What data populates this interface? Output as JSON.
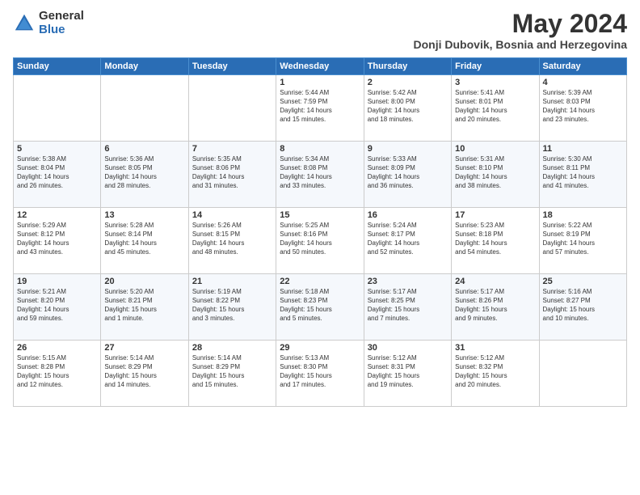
{
  "logo": {
    "general": "General",
    "blue": "Blue"
  },
  "title": "May 2024",
  "location": "Donji Dubovik, Bosnia and Herzegovina",
  "days_of_week": [
    "Sunday",
    "Monday",
    "Tuesday",
    "Wednesday",
    "Thursday",
    "Friday",
    "Saturday"
  ],
  "weeks": [
    [
      {
        "day": "",
        "info": ""
      },
      {
        "day": "",
        "info": ""
      },
      {
        "day": "",
        "info": ""
      },
      {
        "day": "1",
        "info": "Sunrise: 5:44 AM\nSunset: 7:59 PM\nDaylight: 14 hours\nand 15 minutes."
      },
      {
        "day": "2",
        "info": "Sunrise: 5:42 AM\nSunset: 8:00 PM\nDaylight: 14 hours\nand 18 minutes."
      },
      {
        "day": "3",
        "info": "Sunrise: 5:41 AM\nSunset: 8:01 PM\nDaylight: 14 hours\nand 20 minutes."
      },
      {
        "day": "4",
        "info": "Sunrise: 5:39 AM\nSunset: 8:03 PM\nDaylight: 14 hours\nand 23 minutes."
      }
    ],
    [
      {
        "day": "5",
        "info": "Sunrise: 5:38 AM\nSunset: 8:04 PM\nDaylight: 14 hours\nand 26 minutes."
      },
      {
        "day": "6",
        "info": "Sunrise: 5:36 AM\nSunset: 8:05 PM\nDaylight: 14 hours\nand 28 minutes."
      },
      {
        "day": "7",
        "info": "Sunrise: 5:35 AM\nSunset: 8:06 PM\nDaylight: 14 hours\nand 31 minutes."
      },
      {
        "day": "8",
        "info": "Sunrise: 5:34 AM\nSunset: 8:08 PM\nDaylight: 14 hours\nand 33 minutes."
      },
      {
        "day": "9",
        "info": "Sunrise: 5:33 AM\nSunset: 8:09 PM\nDaylight: 14 hours\nand 36 minutes."
      },
      {
        "day": "10",
        "info": "Sunrise: 5:31 AM\nSunset: 8:10 PM\nDaylight: 14 hours\nand 38 minutes."
      },
      {
        "day": "11",
        "info": "Sunrise: 5:30 AM\nSunset: 8:11 PM\nDaylight: 14 hours\nand 41 minutes."
      }
    ],
    [
      {
        "day": "12",
        "info": "Sunrise: 5:29 AM\nSunset: 8:12 PM\nDaylight: 14 hours\nand 43 minutes."
      },
      {
        "day": "13",
        "info": "Sunrise: 5:28 AM\nSunset: 8:14 PM\nDaylight: 14 hours\nand 45 minutes."
      },
      {
        "day": "14",
        "info": "Sunrise: 5:26 AM\nSunset: 8:15 PM\nDaylight: 14 hours\nand 48 minutes."
      },
      {
        "day": "15",
        "info": "Sunrise: 5:25 AM\nSunset: 8:16 PM\nDaylight: 14 hours\nand 50 minutes."
      },
      {
        "day": "16",
        "info": "Sunrise: 5:24 AM\nSunset: 8:17 PM\nDaylight: 14 hours\nand 52 minutes."
      },
      {
        "day": "17",
        "info": "Sunrise: 5:23 AM\nSunset: 8:18 PM\nDaylight: 14 hours\nand 54 minutes."
      },
      {
        "day": "18",
        "info": "Sunrise: 5:22 AM\nSunset: 8:19 PM\nDaylight: 14 hours\nand 57 minutes."
      }
    ],
    [
      {
        "day": "19",
        "info": "Sunrise: 5:21 AM\nSunset: 8:20 PM\nDaylight: 14 hours\nand 59 minutes."
      },
      {
        "day": "20",
        "info": "Sunrise: 5:20 AM\nSunset: 8:21 PM\nDaylight: 15 hours\nand 1 minute."
      },
      {
        "day": "21",
        "info": "Sunrise: 5:19 AM\nSunset: 8:22 PM\nDaylight: 15 hours\nand 3 minutes."
      },
      {
        "day": "22",
        "info": "Sunrise: 5:18 AM\nSunset: 8:23 PM\nDaylight: 15 hours\nand 5 minutes."
      },
      {
        "day": "23",
        "info": "Sunrise: 5:17 AM\nSunset: 8:25 PM\nDaylight: 15 hours\nand 7 minutes."
      },
      {
        "day": "24",
        "info": "Sunrise: 5:17 AM\nSunset: 8:26 PM\nDaylight: 15 hours\nand 9 minutes."
      },
      {
        "day": "25",
        "info": "Sunrise: 5:16 AM\nSunset: 8:27 PM\nDaylight: 15 hours\nand 10 minutes."
      }
    ],
    [
      {
        "day": "26",
        "info": "Sunrise: 5:15 AM\nSunset: 8:28 PM\nDaylight: 15 hours\nand 12 minutes."
      },
      {
        "day": "27",
        "info": "Sunrise: 5:14 AM\nSunset: 8:29 PM\nDaylight: 15 hours\nand 14 minutes."
      },
      {
        "day": "28",
        "info": "Sunrise: 5:14 AM\nSunset: 8:29 PM\nDaylight: 15 hours\nand 15 minutes."
      },
      {
        "day": "29",
        "info": "Sunrise: 5:13 AM\nSunset: 8:30 PM\nDaylight: 15 hours\nand 17 minutes."
      },
      {
        "day": "30",
        "info": "Sunrise: 5:12 AM\nSunset: 8:31 PM\nDaylight: 15 hours\nand 19 minutes."
      },
      {
        "day": "31",
        "info": "Sunrise: 5:12 AM\nSunset: 8:32 PM\nDaylight: 15 hours\nand 20 minutes."
      },
      {
        "day": "",
        "info": ""
      }
    ]
  ]
}
